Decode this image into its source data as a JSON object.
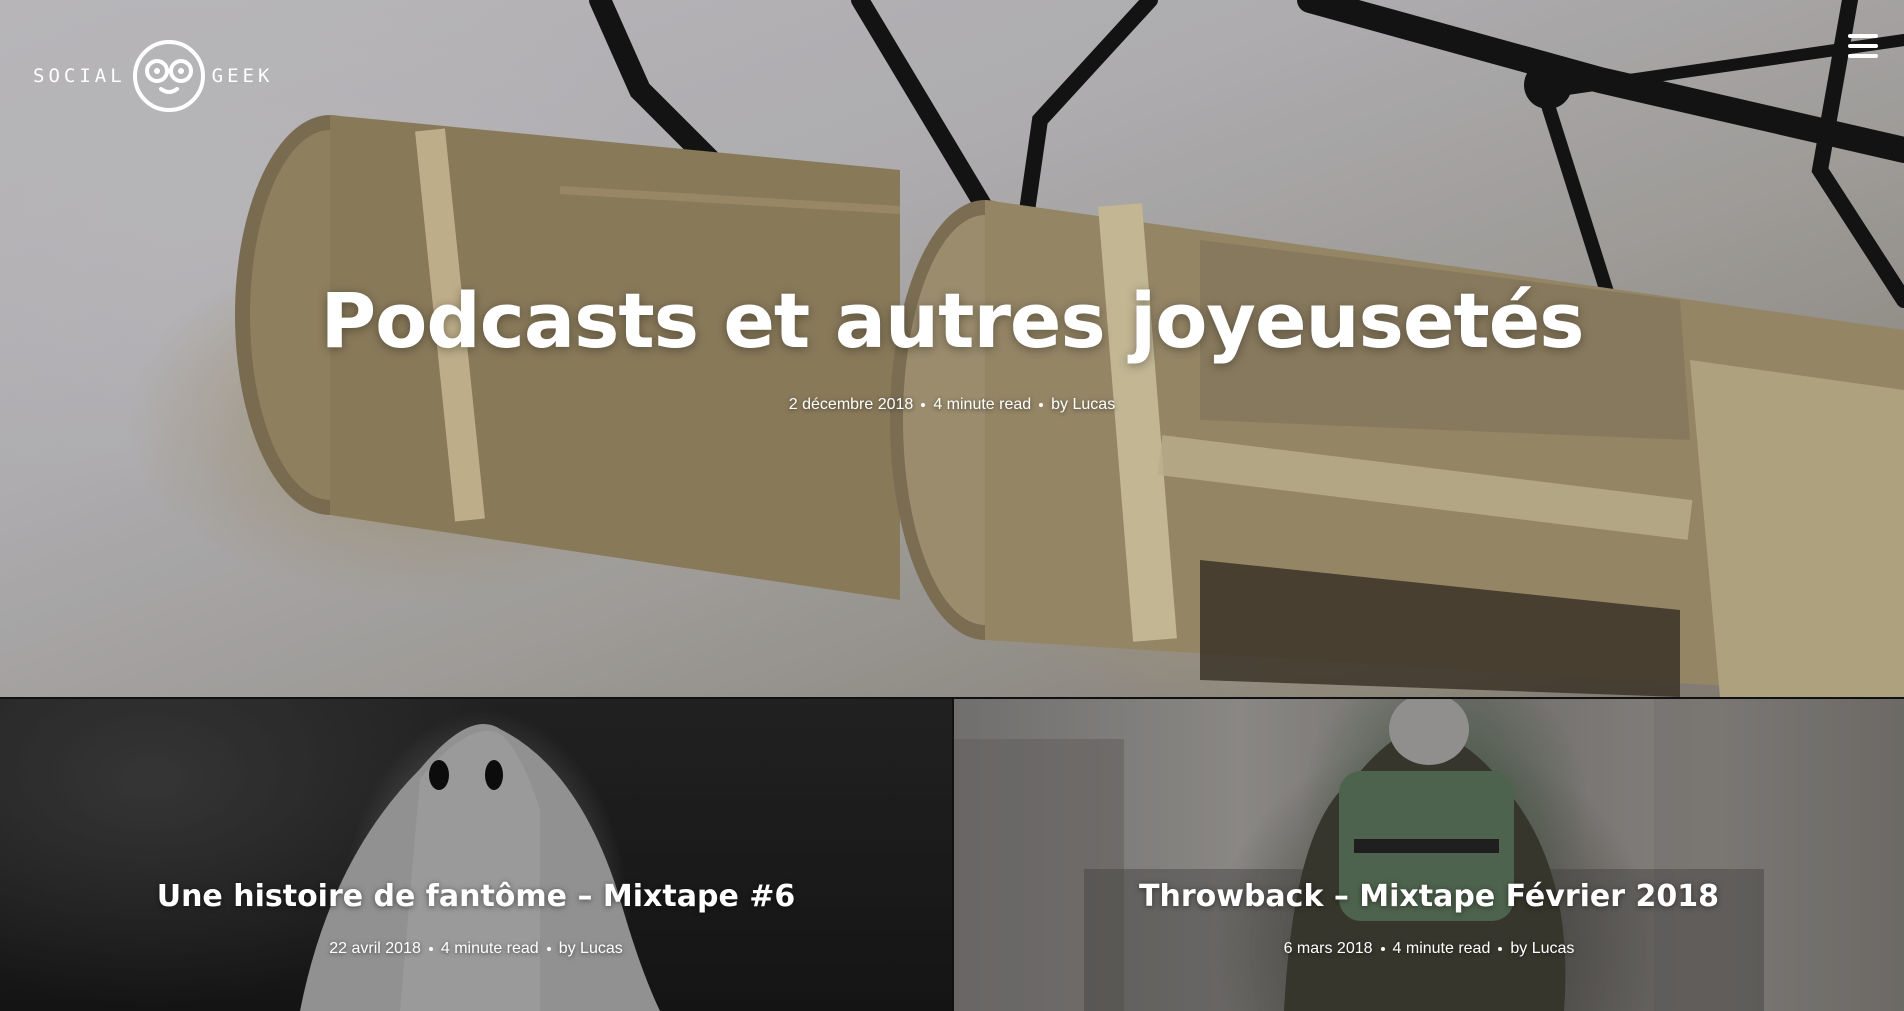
{
  "site": {
    "logo_left": "SOCIAL",
    "logo_right": "GEEK"
  },
  "hero": {
    "title": "Podcasts et autres joyeusetés",
    "date": "2 décembre 2018",
    "read_time": "4 minute read",
    "author": "by Lucas",
    "image_subject": "studio microphones"
  },
  "posts": [
    {
      "title": "Une histoire de fantôme – Mixtape #6",
      "date": "22 avril 2018",
      "read_time": "4 minute read",
      "author": "by Lucas",
      "image_subject": "ghost under white sheet"
    },
    {
      "title": "Throwback – Mixtape Février 2018",
      "date": "6 mars 2018",
      "read_time": "4 minute read",
      "author": "by Lucas",
      "image_subject": "person with green backpack in street"
    }
  ],
  "icons": {
    "menu": "hamburger-menu-icon",
    "logo": "geek-face-glasses-icon"
  }
}
